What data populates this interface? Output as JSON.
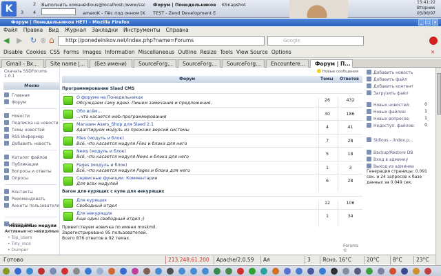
{
  "kde_panel": {
    "desktops": [
      "2",
      "3",
      "4"
    ],
    "tasks": [
      "Выполнить коман",
      "sidious@localhost:/www/ssc",
      "Форум | Понедельников",
      "KSnapshot",
      "amaroK - Пёс под окном [K",
      "TEST - Zend Development E"
    ],
    "clock": {
      "time": "15:41:22",
      "day": "Вторник",
      "date": "05/06/07"
    }
  },
  "window": {
    "title": "Форум | Понедельников НЕТ! - Mozilla Firefox"
  },
  "menu": [
    "Файл",
    "Правка",
    "Вид",
    "Журнал",
    "Закладки",
    "Инструменты",
    "Справка"
  ],
  "navbar": {
    "url": "http://ponedelnikov.net/index.php?name=Forums",
    "search_placeholder": "Google"
  },
  "webdev_toolbar": [
    "Disable",
    "Cookies",
    "CSS",
    "Forms",
    "Images",
    "Information",
    "Miscellaneous",
    "Outline",
    "Resize",
    "Tools",
    "View Source",
    "Options"
  ],
  "tabs": [
    "Gmail - Вх...",
    "Site name |...",
    "(Без имени)",
    "SourceForg...",
    "SourceForg...",
    "SourceForg...",
    "Encountere...",
    "Форум | П..."
  ],
  "left": {
    "download": "Скачать SSDForums 1.0.1",
    "menu_title": "Меню",
    "groups": [
      [
        "Главная",
        "Форум"
      ],
      [
        "Новости",
        "Подписка на новости",
        "Темы новостей",
        "RSS Информер",
        "Добавить новость"
      ],
      [
        "Каталог файлов",
        "Публикации",
        "Вопросы и ответы",
        "Опросы"
      ],
      [
        "Контакты",
        "Рекомендовать",
        "Анкеты пользователя"
      ],
      [
        "Фото дня"
      ]
    ],
    "invisible_title": "Невидимые модули",
    "invisible_sub": "Активные но невидимые",
    "invisible": [
      "Top_Users",
      "Tiny_mce",
      "Dumper"
    ]
  },
  "forum": {
    "new_messages": "Новые сообщения",
    "col_forum": "Форум",
    "col_topics": "Темы",
    "col_replies": "Ответов",
    "categories": [
      {
        "name": "Программирование Slaed CMS",
        "forums": [
          {
            "title": "О форуме на Понедельниках",
            "desc": "Обсуждаем саму идею. Пишем замечания и предложения.",
            "topics": "26",
            "replies": "432"
          },
          {
            "title": "Обо всём...",
            "desc": "...что касается web-программирования",
            "topics": "30",
            "replies": "186"
          },
          {
            "title": "Магазин Asers_Shop для Slaed 2.1",
            "desc": "Адаптируем модуль из прежних версий системы",
            "topics": "4",
            "replies": "41"
          },
          {
            "title": "Files (модуль и блок)",
            "desc": "Всё, что касается модуля Files и блока для него",
            "topics": "7",
            "replies": "28"
          },
          {
            "title": "News (модуль и блок)",
            "desc": "Всё, что касается модуля News и блока для него",
            "topics": "5",
            "replies": "18"
          },
          {
            "title": "Pages (модуль и блок)",
            "desc": "Всё, что касается модуля Pages и блока для него",
            "topics": "1",
            "replies": "3"
          },
          {
            "title": "Сервисные функции: Комментарии",
            "desc": "Для всех модулей",
            "topics": "6",
            "replies": "28"
          }
        ]
      },
      {
        "name": "Вагон для курящих с купе для некурящих",
        "forums": [
          {
            "title": "Для курящих",
            "desc": "Свободный отдел",
            "topics": "12",
            "replies": "106"
          },
          {
            "title": "Для некурящих",
            "desc": "Еще один свободный отдел ;)",
            "topics": "1",
            "replies": "34"
          }
        ]
      }
    ],
    "stats": [
      "Приветствуем новичка по имени moskmil.",
      "Зарегистрировано 95 пользователей.",
      "Всего 876 ответов в 92 темах."
    ],
    "footer": "Forums ©"
  },
  "right": {
    "actions": [
      "Добавить новость",
      "Добавить файл",
      "Добавить контент",
      "Загрузить файл"
    ],
    "counters": [
      {
        "label": "Новых новостей:",
        "value": "0"
      },
      {
        "label": "Новых файлов:",
        "value": "1"
      },
      {
        "label": "Новых вопросов:",
        "value": "1"
      },
      {
        "label": "Недоступ. файлов:",
        "value": "0"
      }
    ],
    "user": "Sidious - /index.p...",
    "admin": [
      "Backup/Restore DB",
      "Вход в админку",
      "Выход из админки"
    ],
    "generation": "Генерация страницы: 0.091 сек. и 24 запросов к базе данных за 0.049 сек."
  },
  "status": {
    "text": "Готово",
    "ip": "213.248.61.200",
    "server": "Apache/2.0.59",
    "kb": "Aя",
    "mail": "3",
    "weather": [
      "Ясно, 16°C",
      "20°C",
      "8°C",
      "23°C"
    ]
  }
}
